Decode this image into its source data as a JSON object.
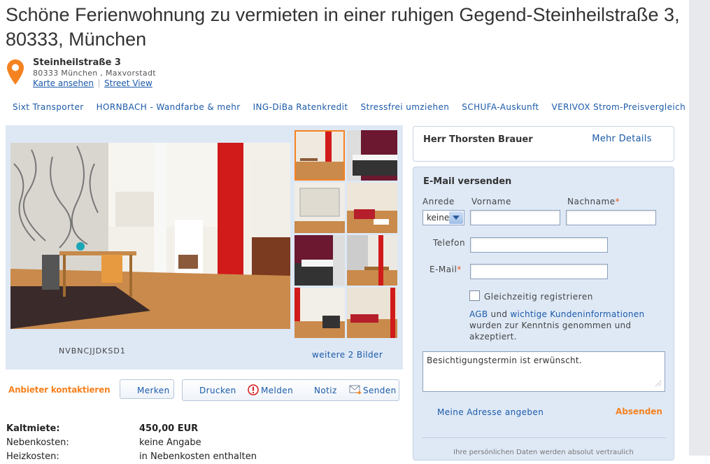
{
  "title": "Schöne Ferienwohnung zu vermieten in einer ruhigen Gegend-Steinheilstraße 3, 80333, München",
  "address": {
    "street": "Steinheilstraße 3",
    "city": "80333 München , Maxvorstadt",
    "map_link": "Karte ansehen",
    "street_view": "Street View"
  },
  "ad_links": [
    "Sixt Transporter",
    "HORNBACH - Wandfarbe & mehr",
    "ING-DiBa Ratenkredit",
    "Stressfrei umziehen",
    "SCHUFA-Auskunft",
    "VERIVOX Strom-Preisvergleich"
  ],
  "gallery": {
    "listing_id": "NVBNCJJDKSD1",
    "more_images": "weitere 2 Bilder",
    "thumbnail_count": 8,
    "selected_thumbnail": 1
  },
  "actions": {
    "contact": "Anbieter kontaktieren",
    "save": "Merken",
    "print": "Drucken",
    "report": "Melden",
    "note": "Notiz",
    "send": "Senden"
  },
  "facts": [
    {
      "label": "Kaltmiete:",
      "value": "450,00 EUR"
    },
    {
      "label": "Nebenkosten:",
      "value": "keine Angabe"
    },
    {
      "label": "Heizkosten:",
      "value": "in Nebenkosten enthalten"
    }
  ],
  "agent": {
    "name": "Herr Thorsten Brauer",
    "more_details": "Mehr Details"
  },
  "form": {
    "title": "E-Mail versenden",
    "salutation_label": "Anrede",
    "salutation_value": "keine",
    "firstname_label": "Vorname",
    "lastname_label": "Nachname",
    "phone_label": "Telefon",
    "email_label": "E-Mail",
    "register_label": "Gleichzeitig registrieren",
    "terms_agb": "AGB",
    "terms_and": " und ",
    "terms_info": "wichtige Kundeninformationen",
    "terms_rest": " wurden zur Kenntnis genommen und akzeptiert.",
    "message": "Besichtigungstermin ist erwünscht.",
    "address_link": "Meine Adresse angeben",
    "submit": "Absenden",
    "privacy": "Ihre persönlichen Daten werden absolut vertraulich"
  },
  "colors": {
    "link": "#1b5aa8",
    "accent": "#f58220",
    "panel": "#dee8f5"
  }
}
